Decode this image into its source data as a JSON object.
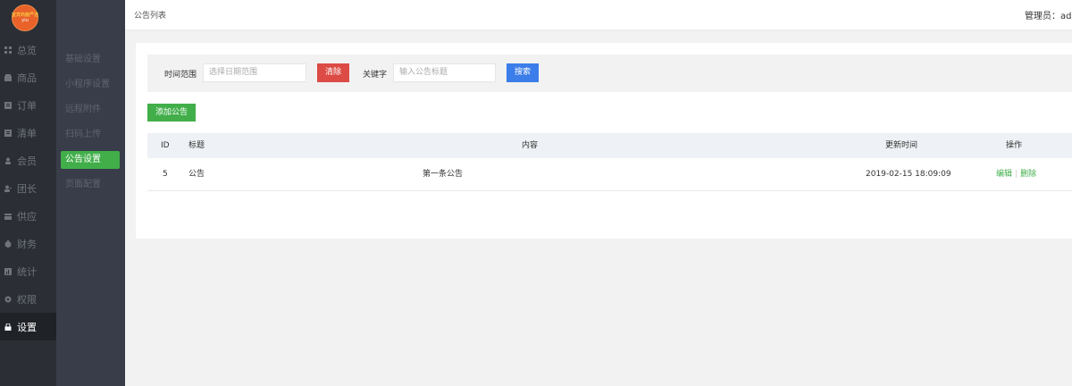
{
  "logo": {
    "line1": "宜宾商鹿严选",
    "line2": "yiu"
  },
  "sidebar": {
    "items": [
      {
        "label": "总览",
        "icon": "grid-icon"
      },
      {
        "label": "商品",
        "icon": "shop-icon"
      },
      {
        "label": "订单",
        "icon": "order-icon"
      },
      {
        "label": "清单",
        "icon": "list-icon"
      },
      {
        "label": "会员",
        "icon": "user-icon"
      },
      {
        "label": "团长",
        "icon": "leader-icon"
      },
      {
        "label": "供应",
        "icon": "supply-icon"
      },
      {
        "label": "财务",
        "icon": "money-icon"
      },
      {
        "label": "统计",
        "icon": "chart-icon"
      },
      {
        "label": "权限",
        "icon": "gear-icon"
      },
      {
        "label": "设置",
        "icon": "lock-icon"
      }
    ],
    "active_index": 10
  },
  "subnav": {
    "items": [
      "基础设置",
      "小程序设置",
      "远程附件",
      "扫码上传",
      "公告设置",
      "页面配置"
    ],
    "active_index": 4
  },
  "header": {
    "title": "公告列表",
    "admin": "管理员：adm"
  },
  "filter": {
    "time_label": "时间范围",
    "time_placeholder": "选择日期范围",
    "clear_label": "清除",
    "keyword_label": "关键字",
    "keyword_placeholder": "输入公告标题",
    "search_label": "搜索"
  },
  "add_label": "添加公告",
  "table": {
    "headers": {
      "id": "ID",
      "title": "标题",
      "content": "内容",
      "time": "更新时间",
      "ops": "操作"
    },
    "rows": [
      {
        "id": "5",
        "title": "公告",
        "content": "第一条公告",
        "time": "2019-02-15 18:09:09",
        "edit": "编辑",
        "delete": "删除"
      }
    ]
  },
  "colors": {
    "green": "#41ae4a",
    "red": "#dd4b46",
    "blue": "#3b7de9",
    "sidebar": "#2b2f35",
    "subnav": "#393d49"
  }
}
